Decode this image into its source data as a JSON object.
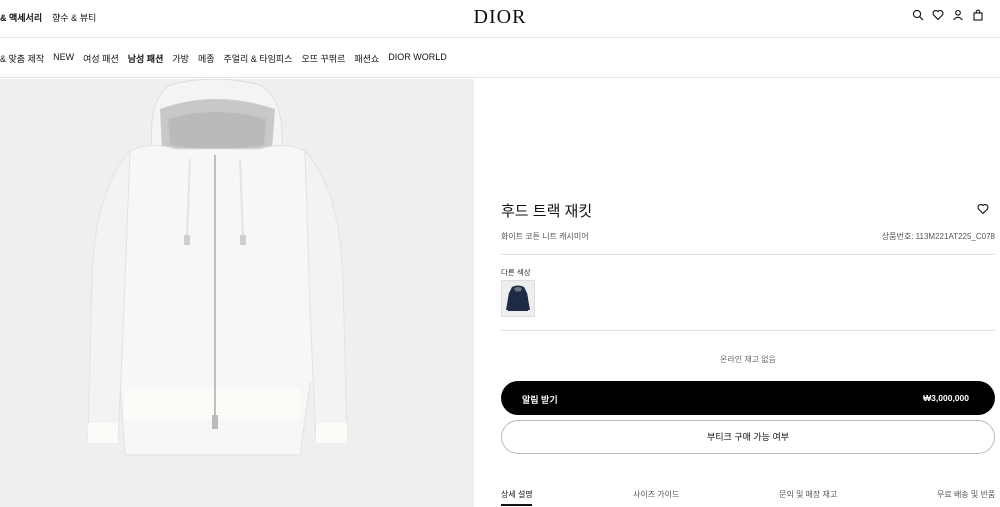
{
  "header": {
    "left_links": [
      "& 액세서리",
      "향수 & 뷰티"
    ],
    "logo": "DIOR",
    "icons": [
      "search-icon",
      "heart-icon",
      "user-icon",
      "bag-icon"
    ]
  },
  "nav": {
    "items": [
      "& 맞춤 제작",
      "NEW",
      "여성 패션",
      "남성 패션",
      "가방",
      "메종",
      "주얼리 & 타임피스",
      "오뜨 꾸뛰르",
      "패션쇼",
      "DIOR WORLD"
    ],
    "active_index": 3
  },
  "product": {
    "title": "후드 트랙 재킷",
    "material": "화이트 코튼 니트 캐시미어",
    "code": "상품번호: 113M221AT225_C078",
    "other_colors_label": "다른 색상",
    "stock_status": "온라인 재고 없음",
    "notify_label": "알림 받기",
    "price": "₩3,000,000",
    "boutique_label": "부티크 구매 가능 여부"
  },
  "tabs": [
    "상세 설명",
    "사이즈 가이드",
    "문의 및 매장 재고",
    "무료 배송 및 반품"
  ],
  "colors": {
    "accent": "#000000",
    "image_bg": "#efefef"
  }
}
